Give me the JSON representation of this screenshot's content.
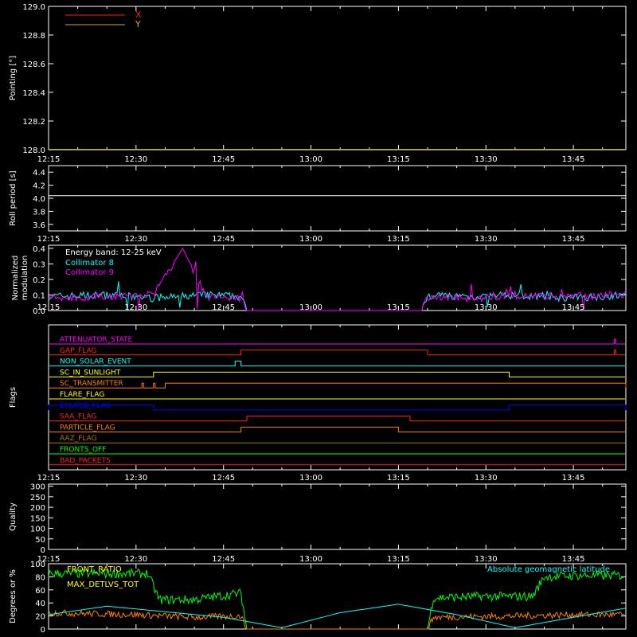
{
  "chart_data": [
    {
      "type": "line",
      "ylabel": "Pointing [°]",
      "ylim": [
        128.0,
        129.0
      ],
      "yticks": [
        "128.0",
        "128.2",
        "128.4",
        "128.6",
        "128.8",
        "129.0"
      ],
      "legend": [
        {
          "name": "X",
          "color": "#ff2020"
        },
        {
          "name": "Y",
          "color": "#c8b400"
        }
      ],
      "series": [
        {
          "name": "X",
          "color": "#ff2020",
          "x": [
            "12:15",
            "13:54"
          ],
          "y": [
            128.0,
            128.0
          ]
        },
        {
          "name": "Y",
          "color": "#c8b400",
          "x": [
            "12:15",
            "13:54"
          ],
          "y": [
            128.0,
            128.0
          ]
        }
      ]
    },
    {
      "type": "line",
      "ylabel": "Roll period [s]",
      "ylim": [
        3.5,
        4.5
      ],
      "yticks": [
        "3.6",
        "3.8",
        "4.0",
        "4.2",
        "4.4"
      ],
      "series": [
        {
          "name": "roll period",
          "color": "#ffffff",
          "x": [
            "12:15",
            "13:54"
          ],
          "y": [
            4.04,
            4.04
          ]
        }
      ]
    },
    {
      "type": "line",
      "ylabel": "Normalized modulation",
      "ylim": [
        0.0,
        0.42
      ],
      "yticks": [
        "0.0",
        "0.1",
        "0.2",
        "0.3",
        "0.4"
      ],
      "annotation": "Energy band: 12-25 keV",
      "legend": [
        {
          "name": "Collimator 8",
          "color": "#00ffff"
        },
        {
          "name": "Collimator 9",
          "color": "#ff00ff"
        }
      ],
      "series": [
        {
          "name": "Collimator 8",
          "color": "#00ffff",
          "x": [
            "12:15",
            "12:24",
            "12:33",
            "12:42",
            "12:48",
            "12:49",
            "13:19",
            "13:20",
            "13:28",
            "13:36",
            "13:44",
            "13:54"
          ],
          "y": [
            0.09,
            0.1,
            0.08,
            0.1,
            0.09,
            0.0,
            0.0,
            0.1,
            0.09,
            0.1,
            0.08,
            0.1
          ]
        },
        {
          "name": "Collimator 9",
          "color": "#ff00ff",
          "x": [
            "12:15",
            "12:24",
            "12:33",
            "12:38",
            "12:42",
            "12:48",
            "12:49",
            "13:19",
            "13:20",
            "13:28",
            "13:36",
            "13:44",
            "13:54"
          ],
          "y": [
            0.08,
            0.09,
            0.1,
            0.4,
            0.09,
            0.08,
            0.0,
            0.0,
            0.09,
            0.08,
            0.1,
            0.09,
            0.1
          ]
        }
      ]
    },
    {
      "type": "line",
      "ylabel": "Flags",
      "flags": [
        {
          "name": "ATTENUATOR_STATE",
          "color": "#ff00ff",
          "intervals": [
            [
              "13:52",
              "13:52"
            ]
          ]
        },
        {
          "name": "GAP_FLAG",
          "color": "#ff2020",
          "intervals": [
            [
              "12:48",
              "13:20"
            ],
            [
              "13:52",
              "13:52"
            ]
          ]
        },
        {
          "name": "NON_SOLAR_EVENT",
          "color": "#00ffff",
          "intervals": [
            [
              "12:47",
              "12:48"
            ]
          ]
        },
        {
          "name": "SC_IN_SUNLIGHT",
          "color": "#ffff00",
          "intervals": [
            [
              "12:33",
              "13:34"
            ]
          ]
        },
        {
          "name": "SC_TRANSMITTER",
          "color": "#ff8000",
          "intervals": [
            [
              "12:31",
              "12:31"
            ],
            [
              "12:33",
              "12:33"
            ],
            [
              "12:35",
              "13:54"
            ]
          ]
        },
        {
          "name": "FLARE_FLAG",
          "color": "#ffff00",
          "intervals": []
        },
        {
          "name": "ECLIPSE_FLAG",
          "color": "#0000ff",
          "intervals": [
            [
              "12:15",
              "12:33"
            ],
            [
              "13:34",
              "13:54"
            ]
          ]
        },
        {
          "name": "SAA_FLAG",
          "color": "#ff2020",
          "intervals": [
            [
              "12:49",
              "13:17"
            ]
          ]
        },
        {
          "name": "PARTICLE_FLAG",
          "color": "#ff8000",
          "intervals": [
            [
              "12:48",
              "13:15"
            ]
          ]
        },
        {
          "name": "AAZ_FLAG",
          "color": "#a08000",
          "intervals": []
        },
        {
          "name": "FRONTS_OFF",
          "color": "#00ff00",
          "intervals": []
        },
        {
          "name": "BAD_PACKETS",
          "color": "#ff2020",
          "intervals": []
        }
      ]
    },
    {
      "type": "line",
      "ylabel": "Quality",
      "ylim": [
        0,
        310
      ],
      "yticks": [
        "0",
        "50",
        "100",
        "150",
        "200",
        "250",
        "300"
      ],
      "series": []
    },
    {
      "type": "line",
      "ylabel": "Degrees or %",
      "ylim": [
        0,
        100
      ],
      "yticks": [
        "0",
        "20",
        "40",
        "60",
        "80",
        "100"
      ],
      "legend": [
        {
          "name": "FRONT_RATIO",
          "color": "#ffff00"
        },
        {
          "name": "MAX_DETLVS_TOT",
          "color": "#ffff00"
        },
        {
          "name": "Absolute geomagnetic latitude",
          "color": "#00ffff"
        }
      ],
      "series": [
        {
          "name": "FRONT_RATIO",
          "color": "#00ff00",
          "x": [
            "12:15",
            "12:25",
            "12:32",
            "12:34",
            "12:40",
            "12:48",
            "12:49",
            "13:20",
            "13:21",
            "13:30",
            "13:38",
            "13:40",
            "13:46",
            "13:54"
          ],
          "y": [
            85,
            85,
            85,
            45,
            45,
            55,
            0,
            0,
            48,
            50,
            50,
            80,
            82,
            82
          ]
        },
        {
          "name": "MAX_DETLVS_TOT",
          "color": "#ff8000",
          "x": [
            "12:15",
            "12:30",
            "12:40",
            "12:48",
            "12:49",
            "13:20",
            "13:21",
            "13:35",
            "13:45",
            "13:54"
          ],
          "y": [
            25,
            22,
            18,
            20,
            0,
            0,
            18,
            20,
            22,
            22
          ]
        },
        {
          "name": "Absolute geomagnetic latitude",
          "color": "#00ffff",
          "x": [
            "12:15",
            "12:25",
            "12:45",
            "12:55",
            "13:05",
            "13:15",
            "13:25",
            "13:35",
            "13:45",
            "13:54"
          ],
          "y": [
            22,
            35,
            18,
            2,
            25,
            38,
            22,
            2,
            18,
            32
          ]
        }
      ]
    }
  ],
  "time_axis": {
    "xlim": [
      "12:15",
      "13:54"
    ],
    "ticks": [
      "12:15",
      "12:30",
      "12:45",
      "13:00",
      "13:15",
      "13:30",
      "13:45"
    ]
  },
  "style": {
    "background": "#000000",
    "axis_color": "#ffffff"
  }
}
